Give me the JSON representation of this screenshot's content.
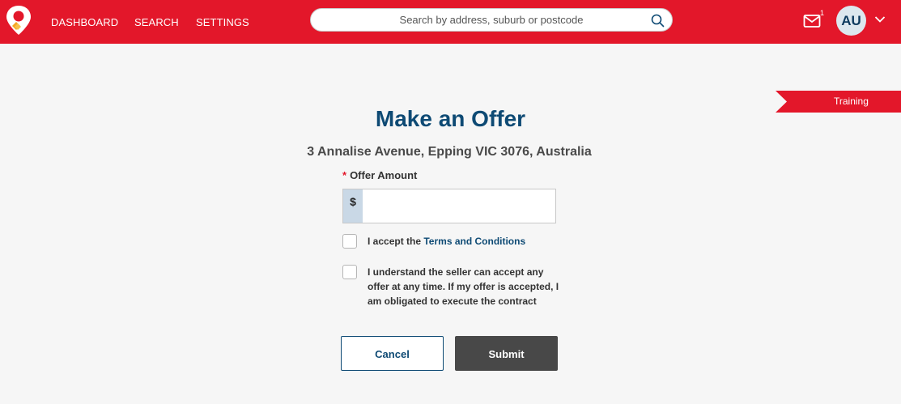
{
  "nav": {
    "items": [
      "DASHBOARD",
      "SEARCH",
      "SETTINGS"
    ]
  },
  "search": {
    "placeholder": "Search by address, suburb or postcode"
  },
  "header": {
    "mail_count": "1",
    "avatar_initials": "AU",
    "icons": [
      "logo-icon",
      "search-icon",
      "mail-icon",
      "chevron-down-icon"
    ]
  },
  "training_ribbon": "Training",
  "page": {
    "title": "Make an Offer",
    "address": "3 Annalise Avenue, Epping VIC 3076, Australia"
  },
  "form": {
    "required_marker": "*",
    "amount_label": "Offer Amount",
    "currency_symbol": "$",
    "amount_value": "",
    "terms_prefix": "I accept the ",
    "terms_link": "Terms and Conditions",
    "understand_text": "I understand the seller can accept any offer at any time. If my offer is accepted, I am obligated to execute the contract",
    "cancel_label": "Cancel",
    "submit_label": "Submit"
  },
  "colors": {
    "brand_red": "#e3172a",
    "navy": "#0e4a74",
    "submit_gray": "#484848"
  }
}
